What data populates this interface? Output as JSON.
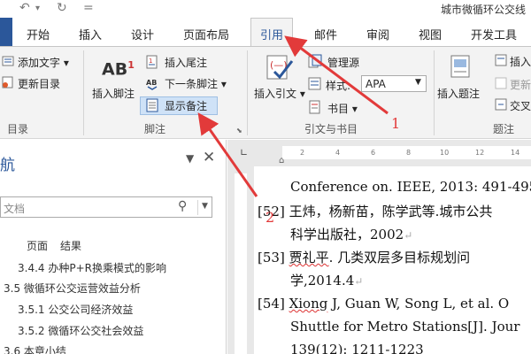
{
  "titlebar": {
    "quick_access": [
      "↶",
      "▾",
      "↻",
      "="
    ],
    "title": "城市微循环公交线"
  },
  "tabs": [
    {
      "label": "开始"
    },
    {
      "label": "插入"
    },
    {
      "label": "设计"
    },
    {
      "label": "页面布局"
    },
    {
      "label": "引用",
      "active": true
    },
    {
      "label": "邮件"
    },
    {
      "label": "审阅"
    },
    {
      "label": "视图"
    },
    {
      "label": "开发工具"
    }
  ],
  "ribbon": {
    "toc_group": {
      "add_text": "添加文字",
      "update_toc": "更新目录",
      "label": "目录"
    },
    "footnote_group": {
      "insert_footnote": "插入脚注",
      "insert_endnote": "插入尾注",
      "next_footnote": "下一条脚注",
      "show_notes": "显示备注",
      "label": "脚注",
      "ab_icon_text": "AB",
      "ab_superscript": "1"
    },
    "citation_group": {
      "insert_citation": "插入引文",
      "manage_sources": "管理源",
      "style_label": "样式:",
      "style_value": "APA",
      "bibliography": "书目",
      "label": "引文与书目"
    },
    "captions_group": {
      "insert_caption": "插入题注",
      "insert_table_figures": "插入",
      "update_table": "更新",
      "cross_reference": "交叉",
      "label": "题注"
    }
  },
  "nav_pane": {
    "title_partial": "航",
    "search_placeholder": "文档",
    "tabs": [
      "页面",
      "结果"
    ],
    "items": [
      "3.4.4 办种P+R换乘模式的影响",
      "3.5 微循环公交运营效益分析",
      "3.5.1 公交公司经济效益",
      "3.5.2 微循环公交社会效益",
      "3.6 本章小结"
    ]
  },
  "document": {
    "ruler_ticks": [
      "2",
      "4",
      "6",
      "8",
      "10",
      "12",
      "14"
    ],
    "lines": [
      {
        "text": "Conference on. IEEE, 2013: 491-495."
      },
      {
        "num": "[52]",
        "text": "王炜，杨新苗，陈学武等.城市公共"
      },
      {
        "text": "科学出版社，2002"
      },
      {
        "num": "[53]",
        "squiggle": "贾礼平",
        "text": ".  几类双层多目标规划问"
      },
      {
        "text": "学,2014.4"
      },
      {
        "num": "[54]",
        "squiggle": "Xiong",
        "text": " J, Guan W, Song L, et al. O"
      },
      {
        "text": "Shuttle for Metro Stations[J]. Jour"
      },
      {
        "text": "139(12): 1211-1223"
      }
    ]
  },
  "annotations": {
    "label_1": "1",
    "label_2": "2",
    "color": "#e23a3a"
  },
  "colors": {
    "accent": "#2b579a",
    "ribbon_bg": "#f3f3f3",
    "selection": "#cfe2f7"
  }
}
